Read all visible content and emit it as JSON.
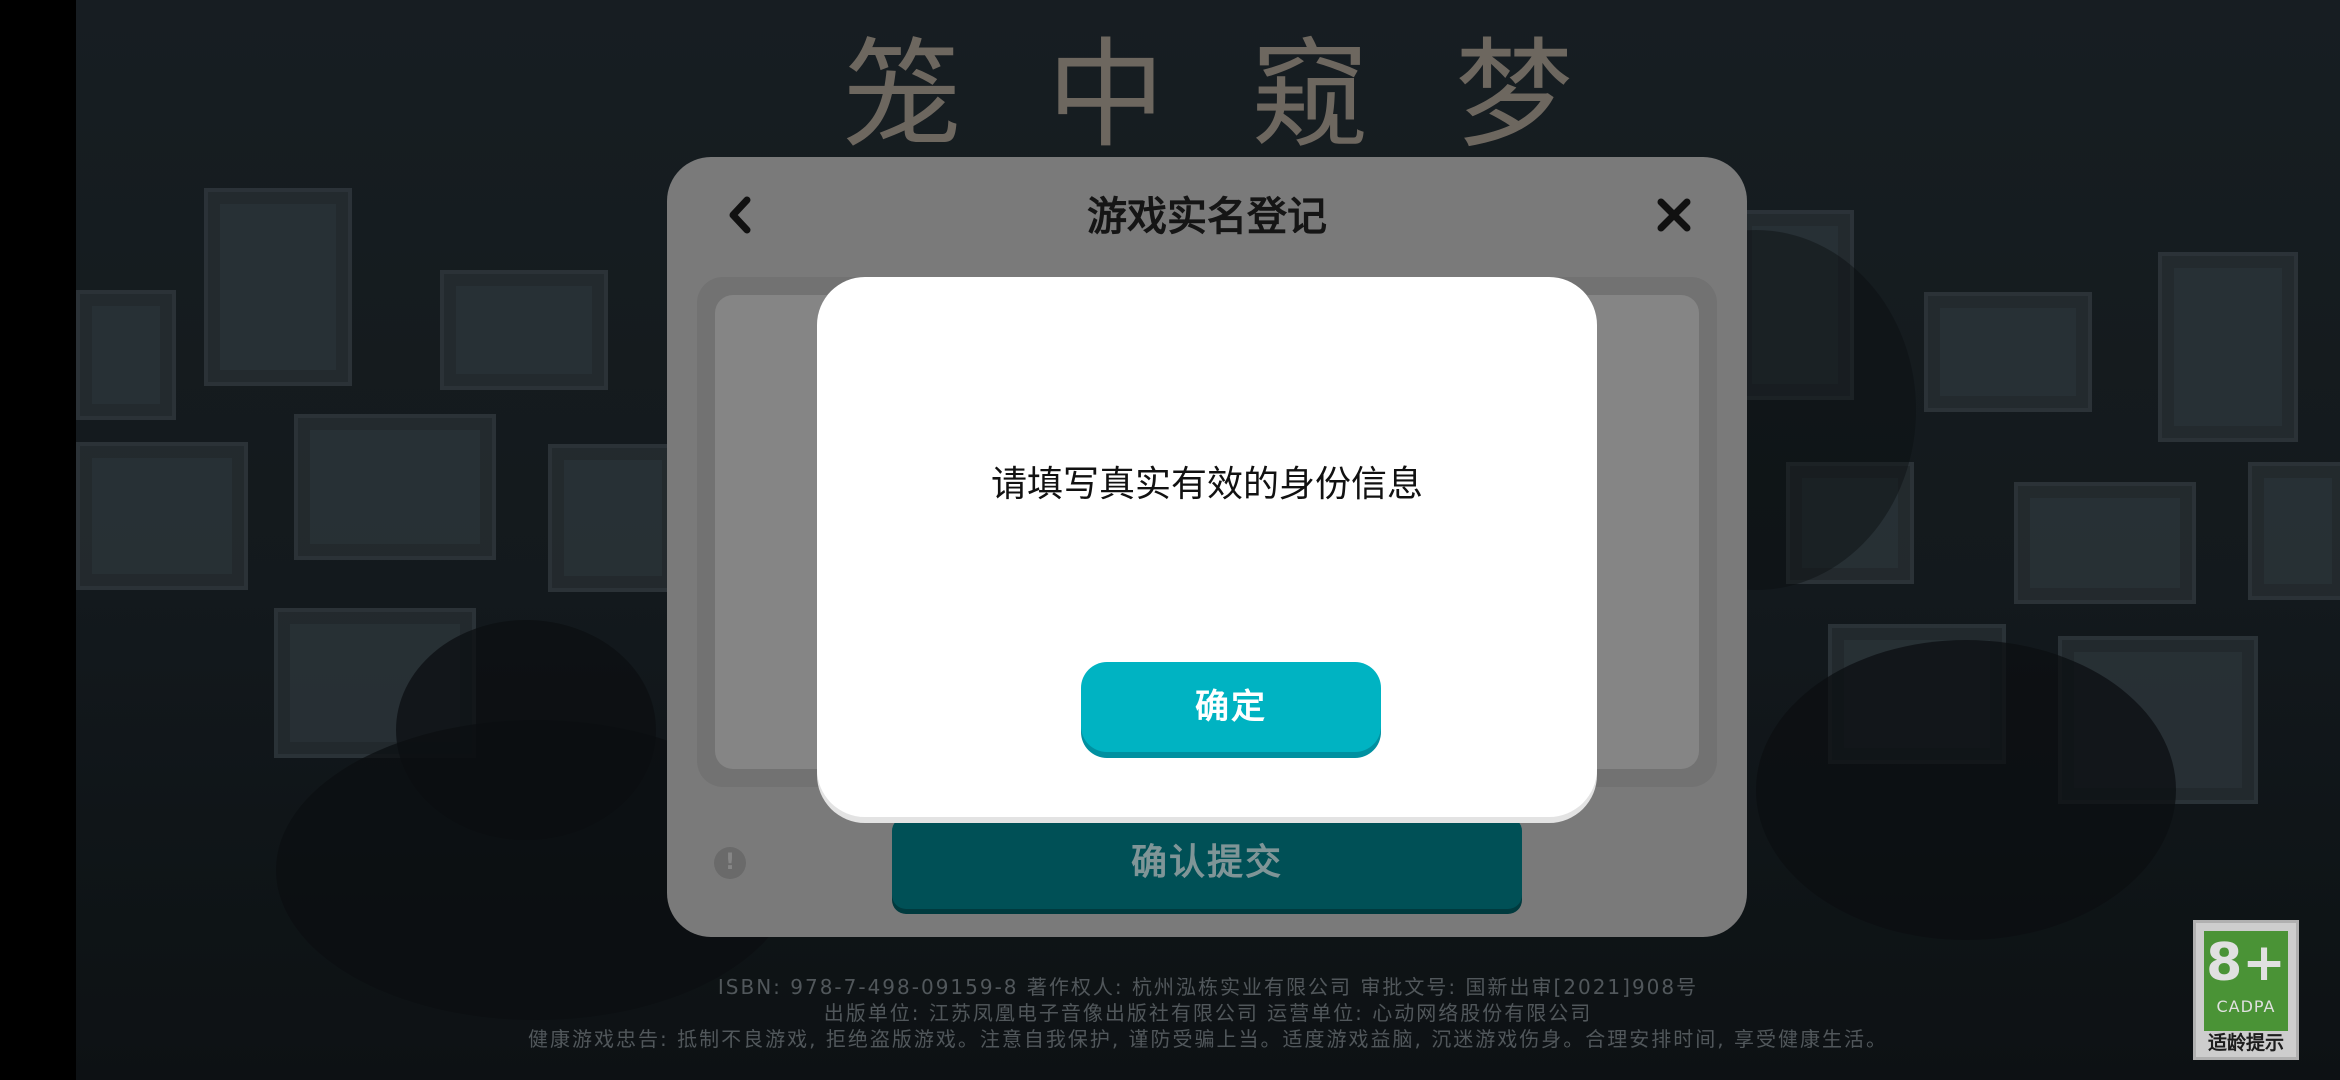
{
  "game": {
    "title": "笼中窥梦"
  },
  "footer": {
    "line1": "ISBN: 978-7-498-09159-8     著作权人: 杭州泓栋实业有限公司 审批文号: 国新出审[2021]908号",
    "line2": "出版单位: 江苏凤凰电子音像出版社有限公司    运营单位: 心动网络股份有限公司",
    "line3": "健康游戏忠告: 抵制不良游戏, 拒绝盗版游戏。注意自我保护, 谨防受骗上当。适度游戏益脑, 沉迷游戏伤身。合理安排时间, 享受健康生活。"
  },
  "age_badge": {
    "rating": "8+",
    "org": "CADPA",
    "tip": "适龄提示",
    "color": "#55a83e"
  },
  "registration": {
    "title": "游戏实名登记",
    "back_icon": "chevron-left-icon",
    "close_icon": "close-icon",
    "info_icon": "info-icon",
    "info_glyph": "!",
    "submit_label": "确认提交"
  },
  "alert": {
    "message": "请填写真实有效的身份信息",
    "ok_label": "确定",
    "accent_color": "#00b3c2"
  }
}
